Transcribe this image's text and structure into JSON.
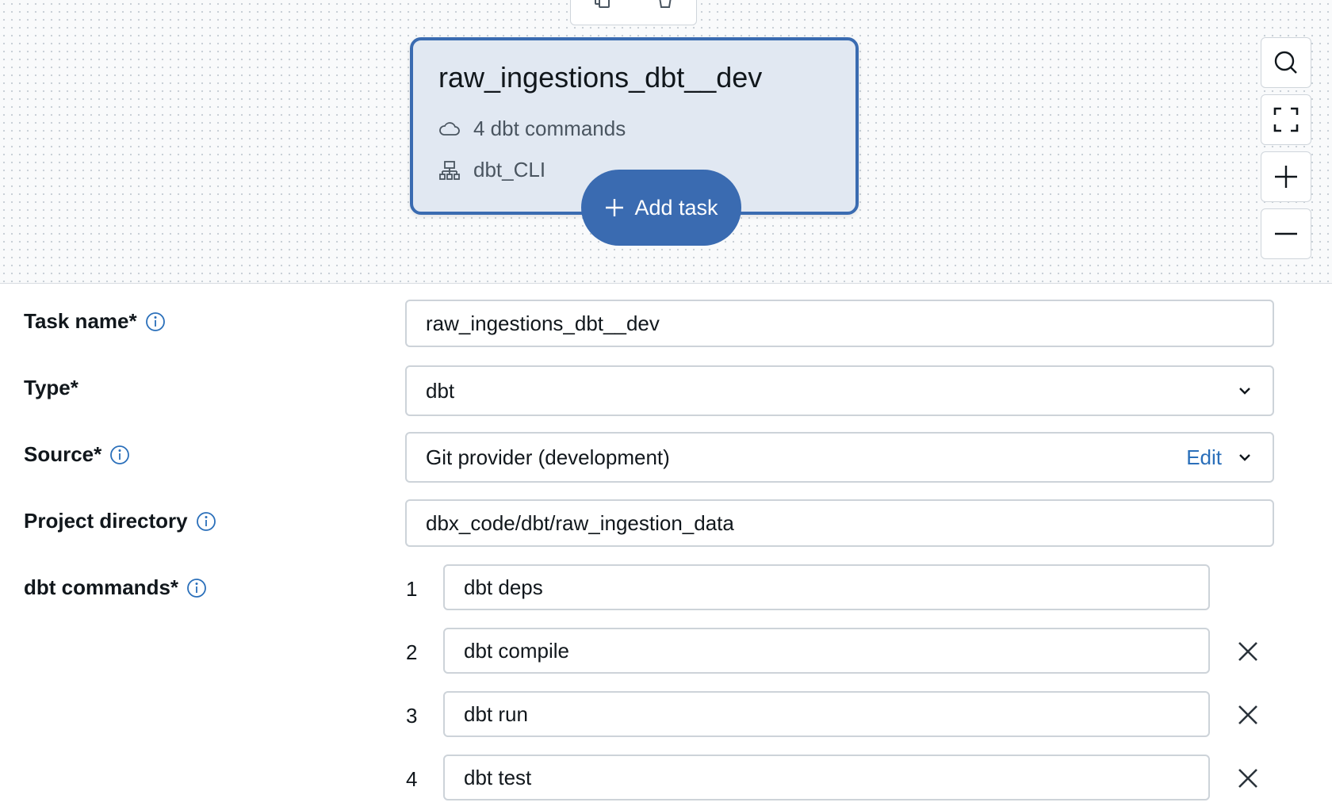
{
  "canvas": {
    "node": {
      "title": "raw_ingestions_dbt__dev",
      "commands_summary": "4 dbt commands",
      "compute": "dbt_CLI"
    },
    "add_task_label": "Add task",
    "toolbar_icons": [
      "copy-icon",
      "delete-icon"
    ],
    "zoom_controls": [
      "search-icon",
      "fit-view-icon",
      "zoom-in-icon",
      "zoom-out-icon"
    ]
  },
  "form": {
    "task_name": {
      "label": "Task name*",
      "value": "raw_ingestions_dbt__dev"
    },
    "type": {
      "label": "Type*",
      "value": "dbt"
    },
    "source": {
      "label": "Source*",
      "value": "Git provider (development)",
      "edit_label": "Edit"
    },
    "project_directory": {
      "label": "Project directory",
      "value": "dbx_code/dbt/raw_ingestion_data"
    },
    "dbt_commands": {
      "label": "dbt commands*",
      "items": [
        {
          "number": "1",
          "value": "dbt deps"
        },
        {
          "number": "2",
          "value": "dbt compile"
        },
        {
          "number": "3",
          "value": "dbt run"
        },
        {
          "number": "4",
          "value": "dbt test"
        }
      ]
    }
  },
  "colors": {
    "accent": "#3a6bb1",
    "node_fill": "#e1e8f2",
    "link": "#2a6fba",
    "border": "#cdd3d9"
  }
}
